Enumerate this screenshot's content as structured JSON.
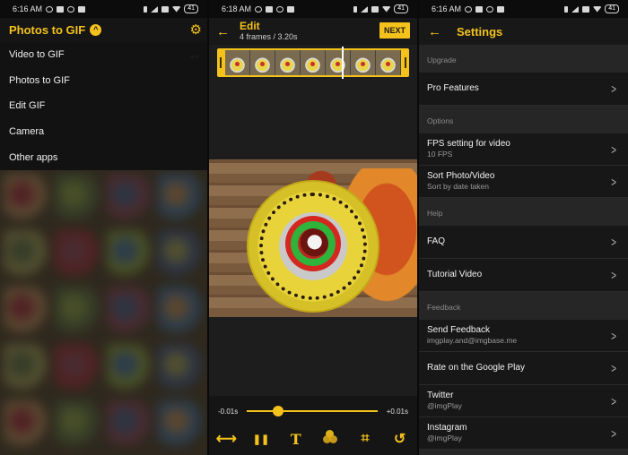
{
  "colors": {
    "accent": "#f4c21b",
    "background": "#1a1a1a"
  },
  "panel1": {
    "status": {
      "time": "6:16 AM",
      "battery": "41"
    },
    "header": {
      "title": "Photos to GIF",
      "toggle_icon": "chevron-up-icon",
      "settings_icon": "gear-icon"
    },
    "menu": [
      {
        "label": "Video to GIF"
      },
      {
        "label": "Photos to GIF"
      },
      {
        "label": "Edit GIF"
      },
      {
        "label": "Camera"
      },
      {
        "label": "Other apps"
      }
    ]
  },
  "panel2": {
    "status": {
      "time": "6:18 AM",
      "battery": "41"
    },
    "header": {
      "title": "Edit",
      "subtitle": "4 frames / 3.20s",
      "next_label": "NEXT"
    },
    "speed": {
      "min_label": "-0.01s",
      "max_label": "+0.01s",
      "position": 0.24
    },
    "toolbar": [
      {
        "name": "direction-icon",
        "glyph": "⟷"
      },
      {
        "name": "pause-icon",
        "glyph": "❚❚"
      },
      {
        "name": "text-icon",
        "glyph": "T"
      },
      {
        "name": "filter-icon",
        "glyph": ""
      },
      {
        "name": "crop-icon",
        "glyph": "⌗"
      },
      {
        "name": "undo-icon",
        "glyph": "↺"
      }
    ]
  },
  "panel3": {
    "status": {
      "time": "6:16 AM",
      "battery": "41"
    },
    "header": {
      "title": "Settings"
    },
    "sections": [
      {
        "label": "Upgrade",
        "items": [
          {
            "title": "Pro Features",
            "subtitle": ""
          }
        ]
      },
      {
        "label": "Options",
        "items": [
          {
            "title": "FPS setting for video",
            "subtitle": "10 FPS"
          },
          {
            "title": "Sort Photo/Video",
            "subtitle": "Sort by date taken"
          }
        ]
      },
      {
        "label": "Help",
        "items": [
          {
            "title": "FAQ",
            "subtitle": ""
          },
          {
            "title": "Tutorial Video",
            "subtitle": ""
          }
        ]
      },
      {
        "label": "Feedback",
        "items": [
          {
            "title": "Send Feedback",
            "subtitle": "imgplay.and@imgbase.me"
          },
          {
            "title": "Rate on the Google Play",
            "subtitle": ""
          },
          {
            "title": "Twitter",
            "subtitle": "@imgPlay"
          },
          {
            "title": "Instagram",
            "subtitle": "@imgPlay"
          }
        ]
      }
    ]
  }
}
